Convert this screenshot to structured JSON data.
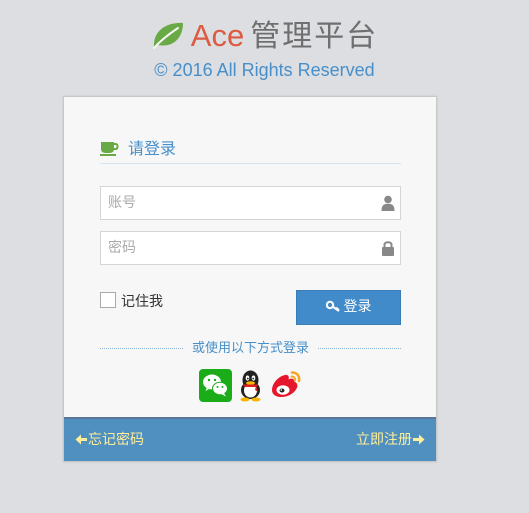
{
  "header": {
    "brand_name": "Ace",
    "brand_title": "管理平台",
    "copyright": "© 2016 All Rights Reserved",
    "logo_icon": "leaf-icon",
    "brand_color": "#dd5a43",
    "accent_color": "#478fca"
  },
  "login": {
    "title": "请登录",
    "title_icon": "coffee-cup-icon",
    "username": {
      "placeholder": "账号",
      "value": "",
      "icon": "user-icon"
    },
    "password": {
      "placeholder": "密码",
      "value": "",
      "icon": "lock-icon"
    },
    "remember_label": "记住我",
    "remember_checked": false,
    "submit_label": "登录",
    "submit_icon": "key-icon",
    "button_color": "#428bca",
    "alt_login_text": "或使用以下方式登录",
    "social": [
      {
        "name": "wechat",
        "icon": "wechat-icon"
      },
      {
        "name": "qq",
        "icon": "qq-icon"
      },
      {
        "name": "weibo",
        "icon": "weibo-icon"
      }
    ]
  },
  "footer": {
    "forgot_label": "忘记密码",
    "register_label": "立即注册",
    "bar_color": "#5090c1",
    "link_color": "#ffee99"
  }
}
